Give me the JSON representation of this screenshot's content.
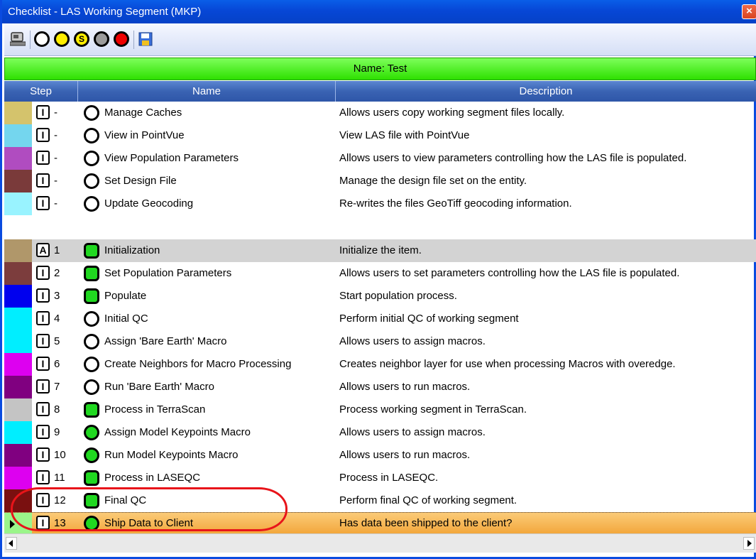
{
  "window": {
    "title": "Checklist - LAS Working Segment (MKP)",
    "close_glyph": "×"
  },
  "toolbar": {
    "items": [
      {
        "icon": "machine-icon"
      },
      {
        "icon": "circle-white-icon",
        "color": "#ffffff"
      },
      {
        "icon": "circle-yellow-icon",
        "color": "#ffee00"
      },
      {
        "icon": "circle-s-icon",
        "color": "#ffee00",
        "label": "S"
      },
      {
        "icon": "circle-grey-icon",
        "color": "#9c9c9c"
      },
      {
        "icon": "circle-red-icon",
        "color": "#ee0000"
      },
      {
        "icon": "save-icon"
      }
    ]
  },
  "namebar": {
    "text": "Name: Test"
  },
  "grid": {
    "columns": [
      "Step",
      "Name",
      "Description"
    ],
    "rows": [
      {
        "swatch": "#d4c36c",
        "badge": "I",
        "step": "-",
        "status": "circle",
        "name": "Manage Caches",
        "description": "Allows users copy working segment files locally."
      },
      {
        "swatch": "#74d6ee",
        "badge": "I",
        "step": "-",
        "status": "circle",
        "name": "View in PointVue",
        "description": "View LAS file with PointVue"
      },
      {
        "swatch": "#b04cc0",
        "badge": "I",
        "step": "-",
        "status": "circle",
        "name": "View Population Parameters",
        "description": "Allows users to view parameters controlling how the LAS file is populated."
      },
      {
        "swatch": "#7a3a3a",
        "badge": "I",
        "step": "-",
        "status": "circle",
        "name": "Set Design File",
        "description": "Manage the design file set on the entity."
      },
      {
        "swatch": "#99f3ff",
        "badge": "I",
        "step": "-",
        "status": "circle",
        "name": "Update Geocoding",
        "description": "Re-writes the files GeoTiff geocoding information."
      },
      {
        "swatch": "#b0976a",
        "badge": "A",
        "step": "1",
        "status": "square",
        "name": "Initialization",
        "description": "Initialize the item.",
        "highlight": "grey"
      },
      {
        "swatch": "#7c3d3d",
        "badge": "I",
        "step": "2",
        "status": "square",
        "name": "Set Population Parameters",
        "description": "Allows users to set parameters controlling how the LAS file is populated."
      },
      {
        "swatch": "#0000ee",
        "badge": "I",
        "step": "3",
        "status": "square",
        "name": "Populate",
        "description": "Start population process."
      },
      {
        "swatch": "#00eeff",
        "badge": "I",
        "step": "4",
        "status": "circle",
        "name": "Initial QC",
        "description": "Perform initial QC of working segment"
      },
      {
        "swatch": "#00eeff",
        "badge": "I",
        "step": "5",
        "status": "circle",
        "name": "Assign 'Bare Earth' Macro",
        "description": "Allows users to assign macros."
      },
      {
        "swatch": "#dd00f0",
        "badge": "I",
        "step": "6",
        "status": "circle",
        "name": "Create Neighbors for Macro Processing",
        "description": "Creates neighbor layer for use when processing Macros with overedge."
      },
      {
        "swatch": "#800080",
        "badge": "I",
        "step": "7",
        "status": "circle",
        "name": "Run 'Bare Earth' Macro",
        "description": "Allows users to run macros."
      },
      {
        "swatch": "#c4c4c4",
        "badge": "I",
        "step": "8",
        "status": "square",
        "name": "Process in TerraScan",
        "description": "Process working segment in TerraScan."
      },
      {
        "swatch": "#00eeff",
        "badge": "I",
        "step": "9",
        "status": "circle-green",
        "name": "Assign Model Keypoints Macro",
        "description": "Allows users to assign macros."
      },
      {
        "swatch": "#800080",
        "badge": "I",
        "step": "10",
        "status": "circle-green",
        "name": "Run Model Keypoints Macro",
        "description": "Allows users to run macros."
      },
      {
        "swatch": "#dd00f0",
        "badge": "I",
        "step": "11",
        "status": "square",
        "name": "Process in LASEQC",
        "description": "Process in LASEQC."
      },
      {
        "swatch": "#7a1010",
        "badge": "I",
        "step": "12",
        "status": "square",
        "name": "Final QC",
        "description": "Perform final QC of working segment."
      },
      {
        "swatch": "#9bf58a",
        "badge": "I",
        "step": "13",
        "status": "circle-green",
        "name": "Ship Data to Client",
        "description": "Has data been shipped to the client?",
        "highlight": "orange",
        "current": true
      }
    ]
  }
}
